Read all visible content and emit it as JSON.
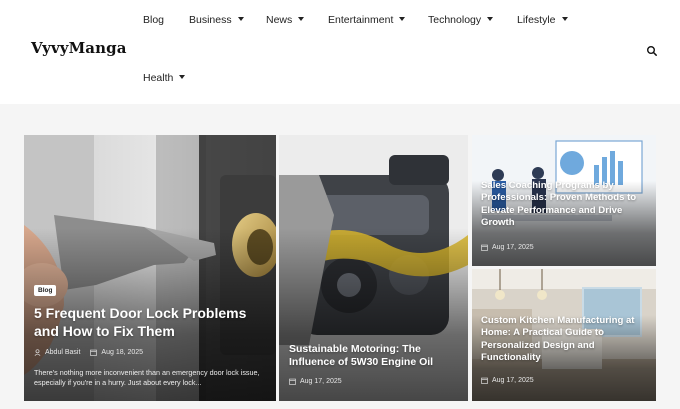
{
  "site": {
    "logo": "VyvyManga"
  },
  "nav": {
    "items": [
      {
        "label": "Blog",
        "dropdown": false
      },
      {
        "label": "Business",
        "dropdown": true
      },
      {
        "label": "News",
        "dropdown": true
      },
      {
        "label": "Entertainment",
        "dropdown": true
      },
      {
        "label": "Technology",
        "dropdown": true
      },
      {
        "label": "Lifestyle",
        "dropdown": true
      },
      {
        "label": "Health",
        "dropdown": true
      }
    ],
    "search_icon": "search-icon"
  },
  "featured": {
    "badge": "Blog",
    "title": "5 Frequent Door Lock Problems and How to Fix Them",
    "author": "Abdul Basit",
    "date": "Aug 18, 2025",
    "excerpt": "There's nothing more inconvenient than an emergency door lock issue, especially if you're in a hurry. Just about every lock..."
  },
  "cards": [
    {
      "title": "Sustainable Motoring: The Influence of 5W30 Engine Oil",
      "date": "Aug 17, 2025"
    },
    {
      "title": "Sales Coaching Programs by Professionals: Proven Methods to Elevate Performance and Drive Growth",
      "date": "Aug 17, 2025"
    },
    {
      "title": "Custom Kitchen Manufacturing at Home: A Practical Guide to Personalized Design and Functionality",
      "date": "Aug 17, 2025"
    }
  ],
  "colors": {
    "header_bg": "#ffffff",
    "content_bg": "#f5f5f5",
    "overlay_text": "#ffffff"
  }
}
